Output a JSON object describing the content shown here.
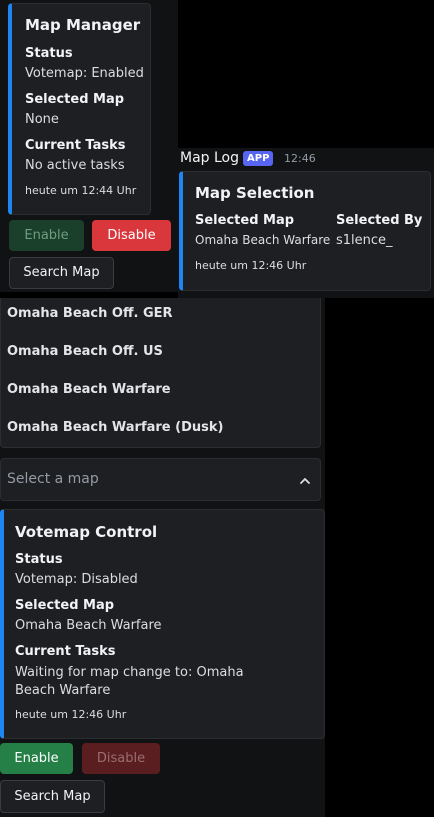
{
  "top_card": {
    "title": "Map Manager",
    "status_label": "Status",
    "status_value": "Votemap: Enabled",
    "selected_map_label": "Selected Map",
    "selected_map_value": "None",
    "tasks_label": "Current Tasks",
    "tasks_value": "No active tasks",
    "timestamp": "heute um 12:44 Uhr",
    "enable_label": "Enable",
    "disable_label": "Disable",
    "search_label": "Search Map"
  },
  "log_message": {
    "author": "Map Log",
    "badge": "APP",
    "time": "12:46",
    "embed_title": "Map Selection",
    "col1_label": "Selected Map",
    "col1_value": "Omaha Beach Warfare",
    "col2_label": "Selected By",
    "col2_value": "s1lence_",
    "timestamp": "heute um 12:46 Uhr"
  },
  "dropdown": {
    "options": [
      "Omaha Beach Off. GER",
      "Omaha Beach Off. US",
      "Omaha Beach Warfare",
      "Omaha Beach Warfare (Dusk)"
    ],
    "placeholder": "Select a map"
  },
  "bottom_card": {
    "title": "Votemap Control",
    "status_label": "Status",
    "status_value": "Votemap: Disabled",
    "selected_map_label": "Selected Map",
    "selected_map_value": "Omaha Beach Warfare",
    "tasks_label": "Current Tasks",
    "tasks_value": "Waiting for map change to: Omaha Beach Warfare",
    "timestamp": "heute um 12:46 Uhr",
    "enable_label": "Enable",
    "disable_label": "Disable",
    "search_label": "Search Map"
  },
  "colors": {
    "embed_accent": "#1d86f0",
    "enable_green": "#248046",
    "disable_red": "#da373c",
    "app_badge": "#5865f2"
  }
}
